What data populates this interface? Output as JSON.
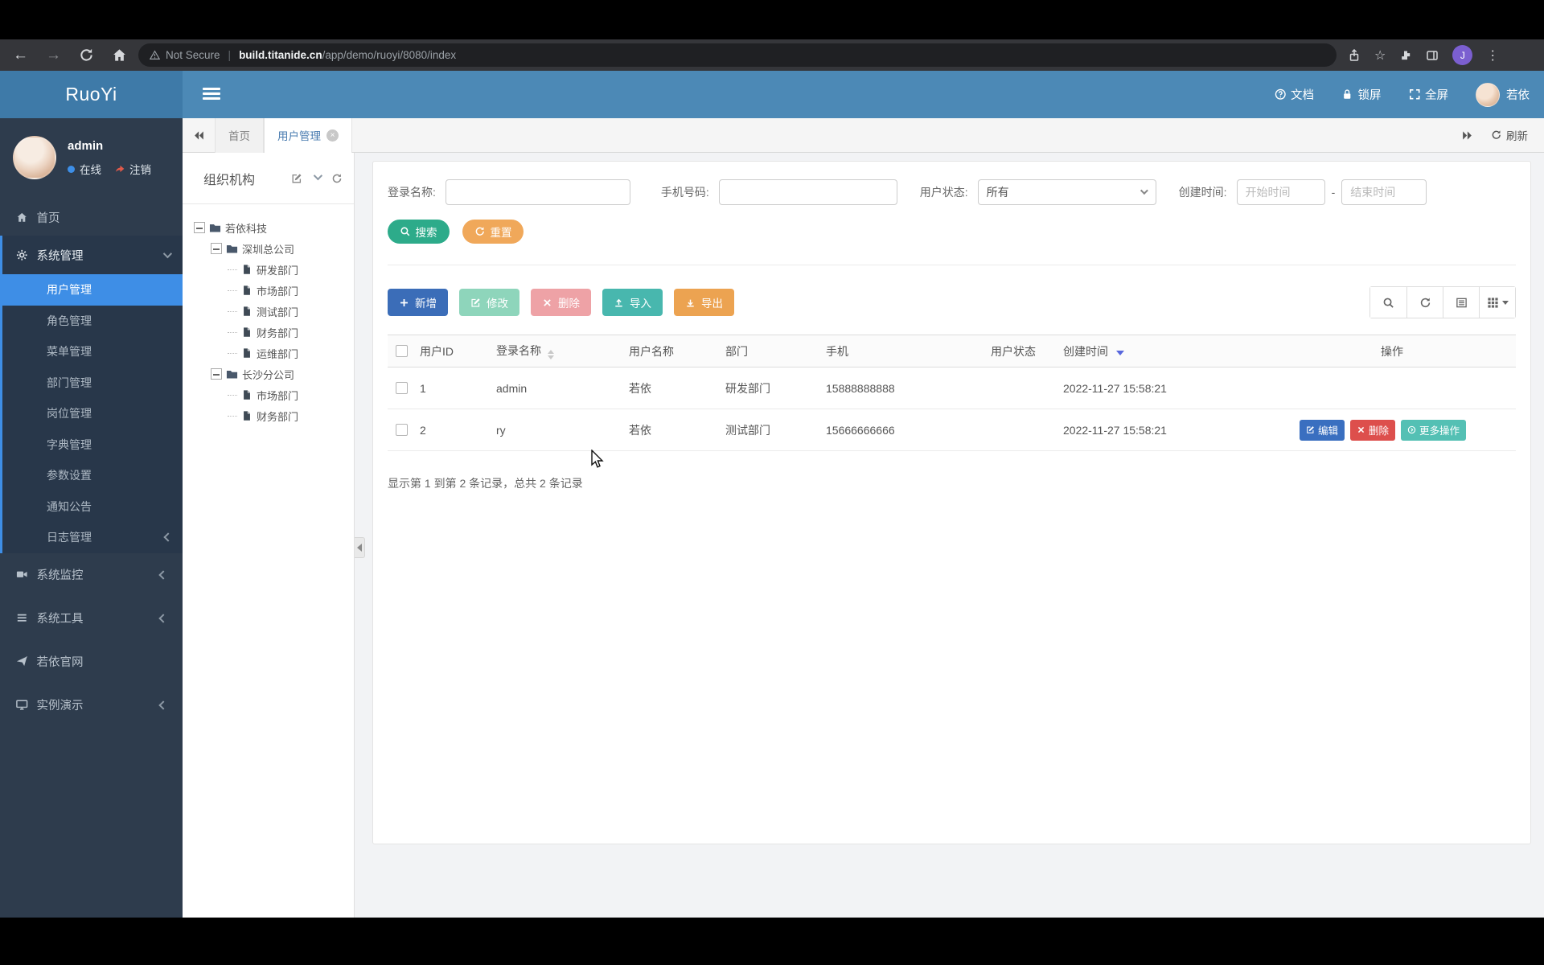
{
  "browser": {
    "security_label": "Not Secure",
    "url_host": "build.titanide.cn",
    "url_path": "/app/demo/ruoyi/8080/index",
    "profile_initial": "J"
  },
  "navbar": {
    "brand": "RuoYi",
    "actions": [
      {
        "icon": "question-circle",
        "label": "文档"
      },
      {
        "icon": "lock",
        "label": "锁屏"
      },
      {
        "icon": "fullscreen",
        "label": "全屏"
      }
    ],
    "username": "若依"
  },
  "sidebar": {
    "user": {
      "name": "admin",
      "status": "在线",
      "logout": "注销"
    },
    "menu": [
      {
        "label": "首页",
        "icon": "home"
      },
      {
        "label": "系统管理",
        "icon": "gear",
        "expanded": true,
        "children": [
          {
            "label": "用户管理",
            "active": true
          },
          {
            "label": "角色管理"
          },
          {
            "label": "菜单管理"
          },
          {
            "label": "部门管理"
          },
          {
            "label": "岗位管理"
          },
          {
            "label": "字典管理"
          },
          {
            "label": "参数设置"
          },
          {
            "label": "通知公告"
          },
          {
            "label": "日志管理",
            "chevron": true
          }
        ]
      },
      {
        "label": "系统监控",
        "icon": "video-camera",
        "chevron": true
      },
      {
        "label": "系统工具",
        "icon": "list",
        "chevron": true
      },
      {
        "label": "若依官网",
        "icon": "paper-plane"
      },
      {
        "label": "实例演示",
        "icon": "monitor",
        "chevron": true
      }
    ]
  },
  "tabbar": {
    "tabs": [
      {
        "label": "首页",
        "active": false,
        "closable": false
      },
      {
        "label": "用户管理",
        "active": true,
        "closable": true
      }
    ],
    "refresh_label": "刷新"
  },
  "tree": {
    "title": "组织机构",
    "nodes": [
      {
        "label": "若依科技",
        "level": 0,
        "type": "folder"
      },
      {
        "label": "深圳总公司",
        "level": 1,
        "type": "folder"
      },
      {
        "label": "研发部门",
        "level": 2,
        "type": "leaf"
      },
      {
        "label": "市场部门",
        "level": 2,
        "type": "leaf"
      },
      {
        "label": "测试部门",
        "level": 2,
        "type": "leaf"
      },
      {
        "label": "财务部门",
        "level": 2,
        "type": "leaf"
      },
      {
        "label": "运维部门",
        "level": 2,
        "type": "leaf"
      },
      {
        "label": "长沙分公司",
        "level": 1,
        "type": "folder"
      },
      {
        "label": "市场部门",
        "level": 2,
        "type": "leaf"
      },
      {
        "label": "财务部门",
        "level": 2,
        "type": "leaf"
      }
    ]
  },
  "search": {
    "login_label": "登录名称:",
    "phone_label": "手机号码:",
    "status_label": "用户状态:",
    "status_value": "所有",
    "created_label": "创建时间:",
    "start_placeholder": "开始时间",
    "range_separator": "-",
    "end_placeholder": "结束时间",
    "search_btn": "搜索",
    "reset_btn": "重置"
  },
  "toolbar": {
    "buttons": [
      {
        "label": "新增",
        "icon": "plus",
        "color": "#3b6db8"
      },
      {
        "label": "修改",
        "icon": "edit",
        "color": "#8ed5bb"
      },
      {
        "label": "删除",
        "icon": "x",
        "color": "#eea2a6"
      },
      {
        "label": "导入",
        "icon": "upload",
        "color": "#48b7ae"
      },
      {
        "label": "导出",
        "icon": "download",
        "color": "#eca351"
      }
    ],
    "view_tools": [
      {
        "icon": "search"
      },
      {
        "icon": "refresh"
      },
      {
        "icon": "detail-view"
      },
      {
        "icon": "grid-columns",
        "caret": true
      }
    ]
  },
  "table": {
    "headers": [
      "用户ID",
      "登录名称",
      "用户名称",
      "部门",
      "手机",
      "用户状态",
      "创建时间",
      "操作"
    ],
    "rows": [
      {
        "id": "1",
        "login": "admin",
        "name": "若依",
        "dept": "研发部门",
        "phone": "15888888888",
        "status_on": true,
        "created": "2022-11-27 15:58:21",
        "actions": []
      },
      {
        "id": "2",
        "login": "ry",
        "name": "若依",
        "dept": "测试部门",
        "phone": "15666666666",
        "status_on": true,
        "created": "2022-11-27 15:58:21",
        "actions": [
          {
            "label": "编辑",
            "icon": "edit",
            "color": "#3a6fc0"
          },
          {
            "label": "删除",
            "icon": "x",
            "color": "#dd4f4c"
          },
          {
            "label": "更多操作",
            "icon": "circle-arrow",
            "color": "#54c0b4"
          }
        ]
      }
    ],
    "summary": "显示第 1 到第 2 条记录，总共 2 条记录"
  }
}
